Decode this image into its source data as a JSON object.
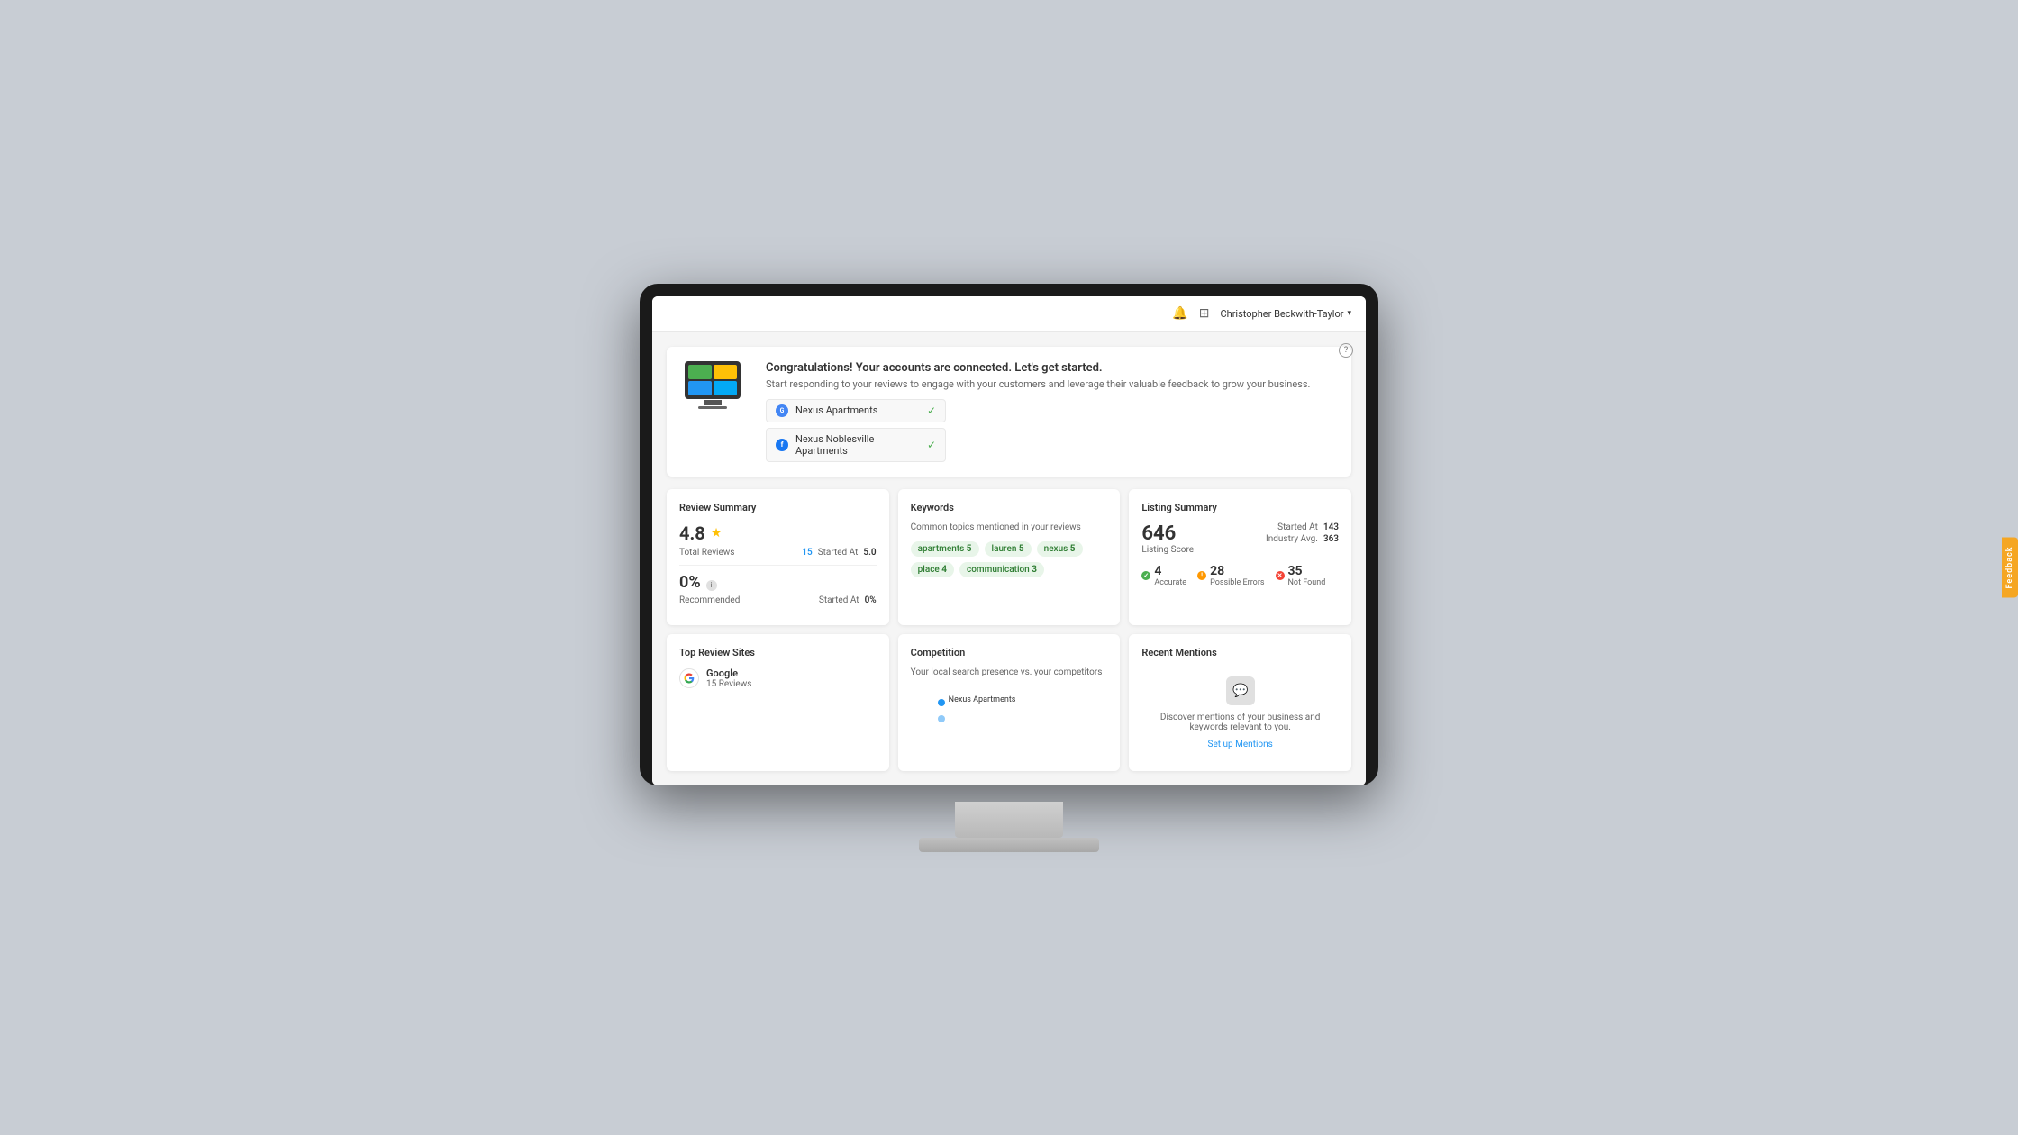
{
  "header": {
    "notification_icon": "🔔",
    "grid_icon": "⊞",
    "user_name": "Christopher Beckwith-Taylor"
  },
  "congrats": {
    "title": "Congratulations! Your accounts are connected. Let's get started.",
    "subtitle": "Start responding to your reviews to engage with your customers and leverage their valuable feedback to grow your business.",
    "accounts": [
      {
        "name": "Nexus Apartments",
        "type": "google",
        "icon_label": "G",
        "connected": true
      },
      {
        "name": "Nexus Noblesville Apartments",
        "type": "facebook",
        "icon_label": "f",
        "connected": true
      }
    ]
  },
  "review_summary": {
    "title": "Review Summary",
    "score": "4.8",
    "total_reviews_label": "Total Reviews",
    "total_reviews_value": "15",
    "started_at_label": "Started At",
    "started_at_value": "5.0",
    "recommended_label": "Recommended",
    "recommended_value": "0%",
    "recommended_started_label": "Started At",
    "recommended_started_value": "0%"
  },
  "keywords": {
    "title": "Keywords",
    "subtitle": "Common topics mentioned in your reviews",
    "tags": [
      {
        "label": "apartments",
        "count": "5"
      },
      {
        "label": "lauren",
        "count": "5"
      },
      {
        "label": "nexus",
        "count": "5"
      },
      {
        "label": "place",
        "count": "4"
      },
      {
        "label": "communication",
        "count": "3"
      }
    ]
  },
  "listing_summary": {
    "title": "Listing Summary",
    "score": "646",
    "score_label": "Listing Score",
    "started_at_label": "Started At",
    "started_at_value": "143",
    "industry_avg_label": "Industry Avg.",
    "industry_avg_value": "363",
    "metrics": [
      {
        "label": "Accurate",
        "value": "4",
        "type": "green"
      },
      {
        "label": "Possible Errors",
        "value": "28",
        "type": "orange"
      },
      {
        "label": "Not Found",
        "value": "35",
        "type": "red"
      }
    ]
  },
  "top_review_sites": {
    "title": "Top Review Sites",
    "sites": [
      {
        "name": "Google",
        "reviews_label": "15 Reviews"
      }
    ]
  },
  "competition": {
    "title": "Competition",
    "subtitle": "Your local search presence vs. your competitors",
    "dot_label": "Nexus Apartments"
  },
  "recent_mentions": {
    "title": "Recent Mentions",
    "description": "Discover mentions of your business and keywords relevant to you.",
    "cta": "Set up Mentions"
  },
  "feedback": {
    "label": "Feedback"
  }
}
